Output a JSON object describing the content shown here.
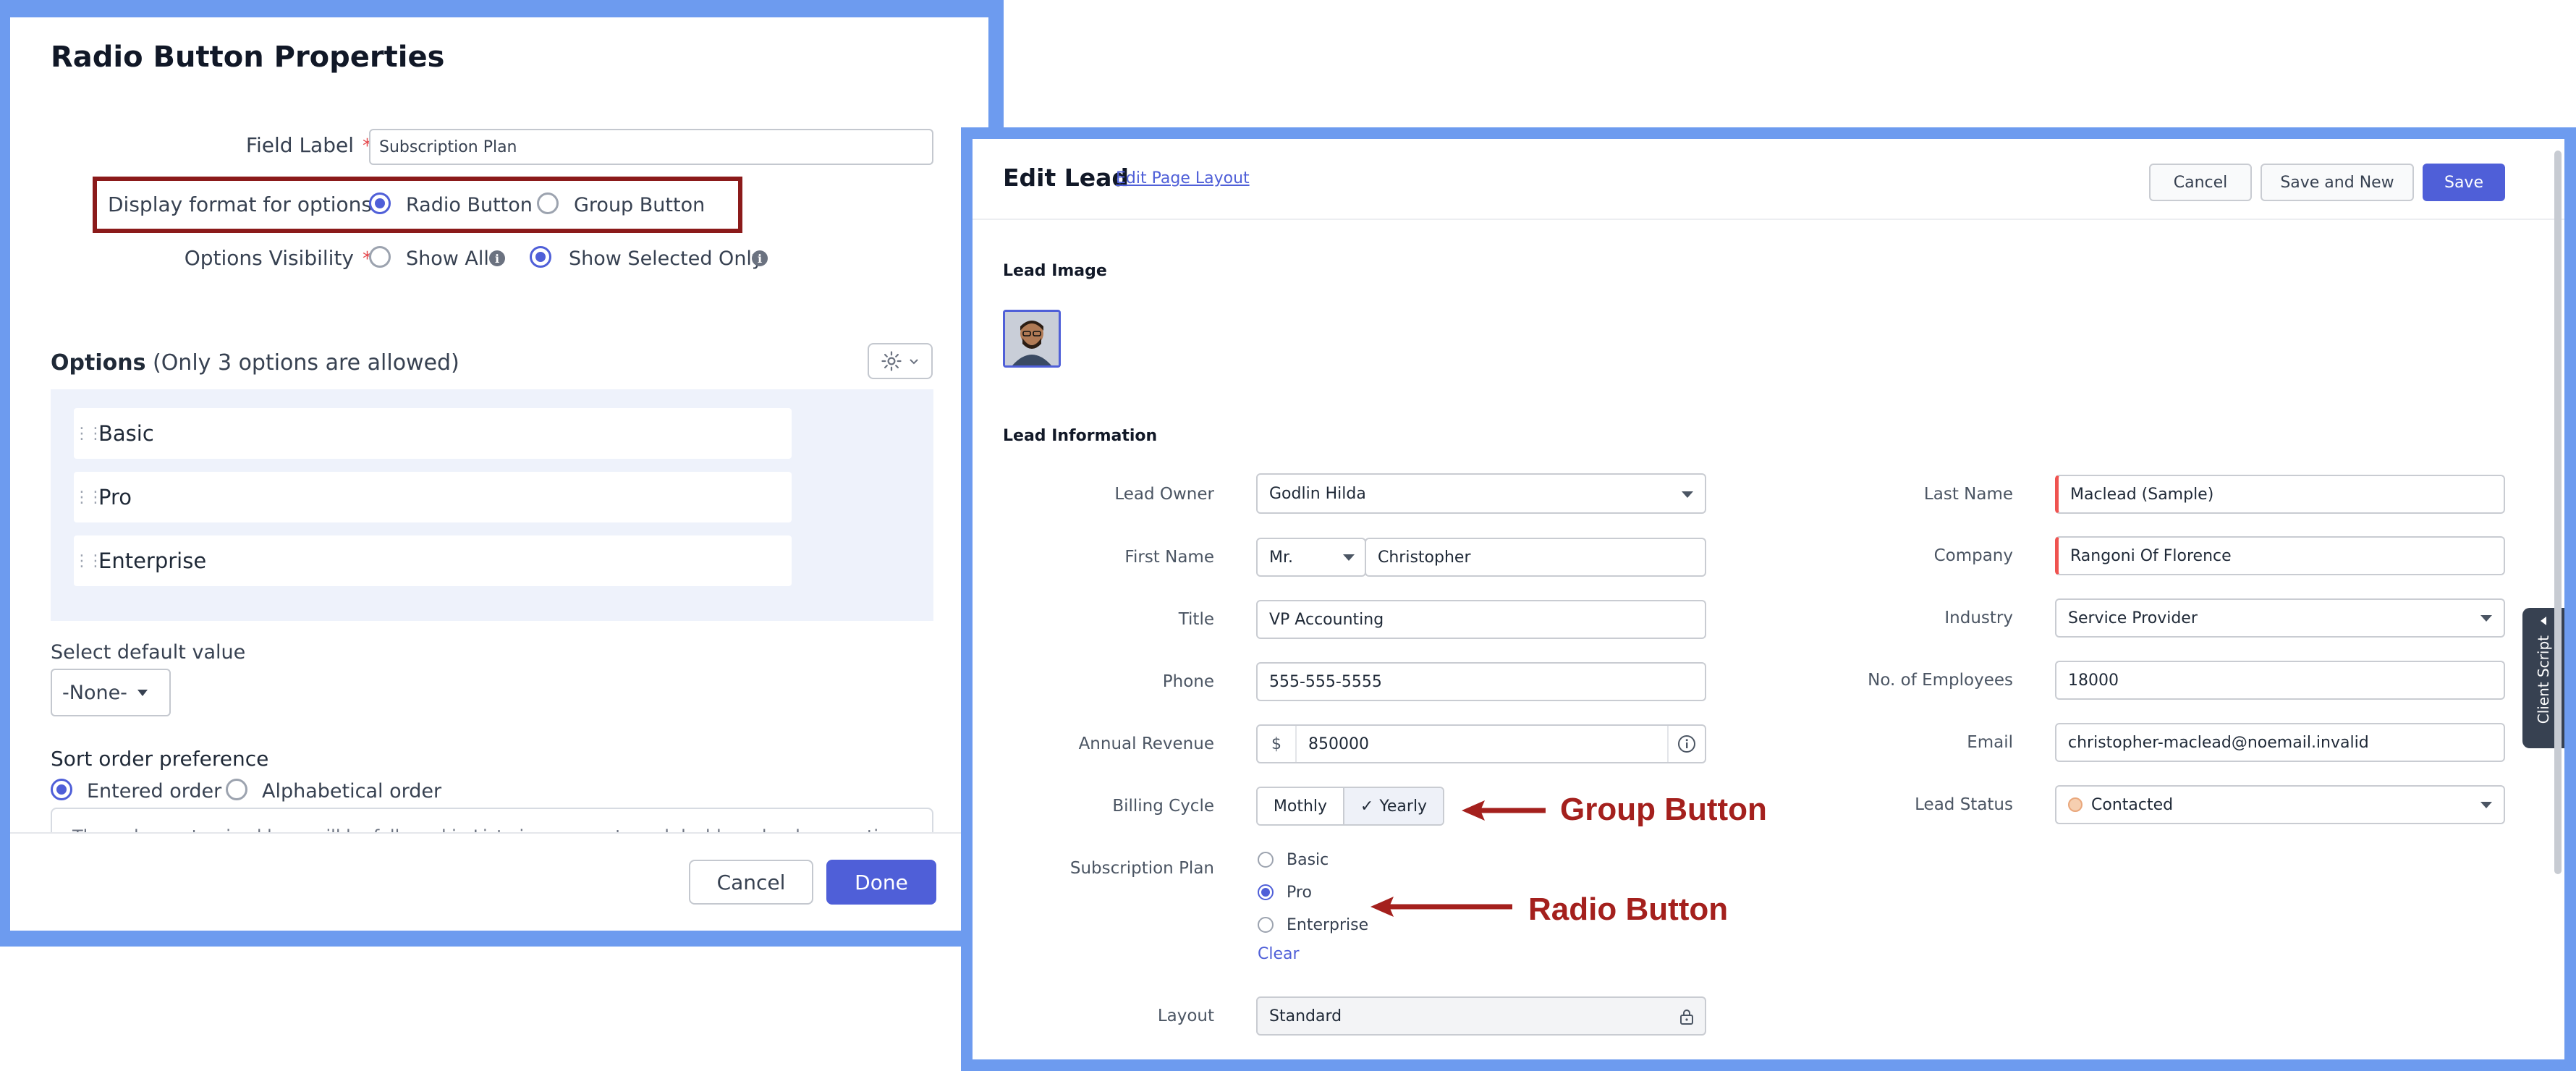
{
  "left_panel": {
    "title": "Radio Button Properties",
    "field_label": {
      "label": "Field Label",
      "value": "Subscription Plan"
    },
    "display_format": {
      "label": "Display format for options",
      "option_radio": "Radio Button",
      "option_group": "Group Button",
      "selected": "Radio Button"
    },
    "options_visibility": {
      "label": "Options Visibility",
      "show_all": "Show All",
      "show_selected": "Show Selected Only",
      "selected": "Show Selected Only"
    },
    "options_heading": "Options",
    "options_note": "(Only 3 options are allowed)",
    "options": [
      "Basic",
      "Pro",
      "Enterprise"
    ],
    "default_value": {
      "label": "Select default value",
      "value": "-None-"
    },
    "sort_order": {
      "label": "Sort order preference",
      "entered": "Entered order",
      "alphabetical": "Alphabetical order",
      "selected": "Entered order"
    },
    "truncated_note": "The order customized here will be followed in List views, reports and dashboards where sorting",
    "cancel_label": "Cancel",
    "done_label": "Done",
    "highlight_color": "#8b1a1a",
    "accent_color": "#4f5fd8"
  },
  "right_panel": {
    "title": "Edit Lead",
    "edit_layout_link": "Edit Page Layout",
    "cancel_label": "Cancel",
    "save_new_label": "Save and New",
    "save_label": "Save",
    "lead_image_heading": "Lead Image",
    "lead_info_heading": "Lead Information",
    "fields": {
      "lead_owner": {
        "label": "Lead Owner",
        "value": "Godlin Hilda"
      },
      "first_name": {
        "label": "First Name",
        "salutation": "Mr.",
        "value": "Christopher"
      },
      "title": {
        "label": "Title",
        "value": "VP Accounting"
      },
      "phone": {
        "label": "Phone",
        "value": "555-555-5555"
      },
      "annual_revenue": {
        "label": "Annual Revenue",
        "currency": "$",
        "value": "850000"
      },
      "billing_cycle": {
        "label": "Billing Cycle",
        "option_1": "Mothly",
        "option_2": "Yearly",
        "selected": "Yearly"
      },
      "subscription_plan": {
        "label": "Subscription Plan",
        "options": [
          "Basic",
          "Pro",
          "Enterprise"
        ],
        "selected": "Pro",
        "clear_label": "Clear"
      },
      "layout": {
        "label": "Layout",
        "value": "Standard"
      },
      "last_name": {
        "label": "Last Name",
        "value": "Maclead (Sample)"
      },
      "company": {
        "label": "Company",
        "value": "Rangoni Of Florence"
      },
      "industry": {
        "label": "Industry",
        "value": "Service Provider"
      },
      "employees": {
        "label": "No. of Employees",
        "value": "18000"
      },
      "email": {
        "label": "Email",
        "value": "christopher-maclead@noemail.invalid"
      },
      "lead_status": {
        "label": "Lead Status",
        "value": "Contacted"
      }
    },
    "client_script_label": "Client Script",
    "annotation_group": "Group Button",
    "annotation_radio": "Radio Button",
    "annotation_color": "#a4201d",
    "save_color": "#4f5fd8"
  }
}
